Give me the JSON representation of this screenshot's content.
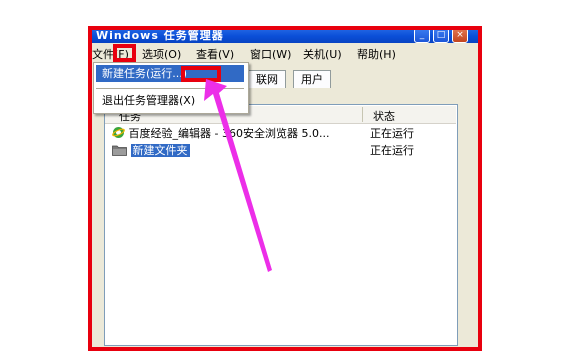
{
  "window": {
    "title": "Windows 任务管理器",
    "controls": [
      "_",
      "□",
      "×"
    ]
  },
  "menubar": {
    "items": [
      "文件(F)",
      "选项(O)",
      "查看(V)",
      "窗口(W)",
      "关机(U)",
      "帮助(H)"
    ]
  },
  "tabs": [
    "联网",
    "用户"
  ],
  "file_menu": {
    "items": [
      "新建任务(运行...)",
      "退出任务管理器(X)"
    ],
    "highlighted": "新建任务(运行...)"
  },
  "task_list": {
    "columns": [
      "任务",
      "状态"
    ],
    "rows": [
      {
        "name": "百度经验_编辑器 - 360安全浏览器 5.0...",
        "status": "正在运行",
        "icon": "ie-browser-icon",
        "selected": false
      },
      {
        "name": "新建文件夹",
        "status": "正在运行",
        "icon": "folder-icon",
        "selected": true
      }
    ]
  },
  "annotation": {
    "frame_color": "#e8000e",
    "arrow_color": "#ec2ee8"
  }
}
